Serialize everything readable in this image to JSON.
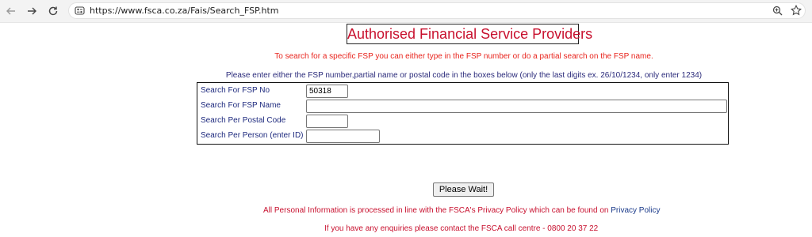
{
  "browser": {
    "url": "https://www.fsca.co.za/Fais/Search_FSP.htm",
    "icons": [
      "back-arrow-icon",
      "forward-arrow-icon",
      "reload-icon",
      "site-info-icon",
      "zoom-icon",
      "star-icon"
    ]
  },
  "page": {
    "title": "Authorised Financial Service Providers",
    "intro": "To search for a specific FSP you can either type in the FSP number or do a partial search on the FSP name.",
    "instruction": "Please enter either the FSP number,partial name or postal code in the boxes below (only the last digits ex. 26/10/1234, only enter 1234)",
    "form": {
      "fsp_no": {
        "label": "Search For FSP No",
        "value": "50318"
      },
      "fsp_name": {
        "label": "Search For FSP Name",
        "value": ""
      },
      "postal_code": {
        "label": "Search Per Postal Code",
        "value": ""
      },
      "person": {
        "label": "Search Per Person (enter ID)",
        "value": ""
      }
    },
    "wait_button": "Please Wait!",
    "privacy_text": "All Personal Information is processed in line with the FSCA's Privacy Policy which can be found on ",
    "privacy_link": "Privacy Policy",
    "enquiry_text": "If you have any enquiries please contact the FSCA call centre - 0800 20 37 22"
  },
  "colors": {
    "title_red": "#c8102e",
    "intro_red": "#e8231c",
    "navy_label": "#1e2a7e"
  }
}
